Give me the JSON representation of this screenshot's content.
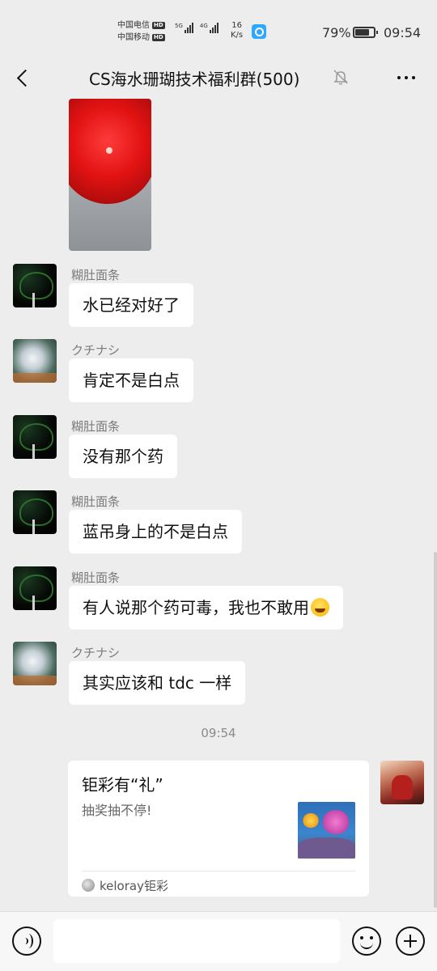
{
  "status_bar": {
    "carrier1": "中国电信",
    "carrier2": "中国移动",
    "hd_badge": "HD",
    "net1": "5G",
    "net2": "4G",
    "speed_value": "16",
    "speed_unit": "K/s",
    "battery_percent": "79%",
    "battery_level": 0.79,
    "time": "09:54"
  },
  "nav": {
    "title": "CS海水珊瑚技术福利群(500)",
    "icons": {
      "back": "chevron-left-icon",
      "mute": "bell-off-icon",
      "more": "more-dots-icon"
    }
  },
  "messages": [
    {
      "sender": "糊肚面条",
      "text": "水已经对好了"
    },
    {
      "sender": "クチナシ",
      "text": "肯定不是白点"
    },
    {
      "sender": "糊肚面条",
      "text": "没有那个药"
    },
    {
      "sender": "糊肚面条",
      "text": "蓝吊身上的不是白点"
    },
    {
      "sender": "糊肚面条",
      "text": "有人说那个药可毒，我也不敢用"
    },
    {
      "sender": "クチナシ",
      "text": "其实应该和 tdc 一样"
    }
  ],
  "timestamp": "09:54",
  "card": {
    "title": "钜彩有“礼”",
    "description": "抽奖抽不停!",
    "source": "keloray钜彩"
  },
  "input_bar": {
    "icons": {
      "voice": "voice-icon",
      "emoji": "emoji-icon",
      "plus": "plus-icon"
    },
    "placeholder": ""
  },
  "colors": {
    "background": "#ededed",
    "bubble": "#ffffff",
    "sender_text": "#7a7a7a"
  }
}
